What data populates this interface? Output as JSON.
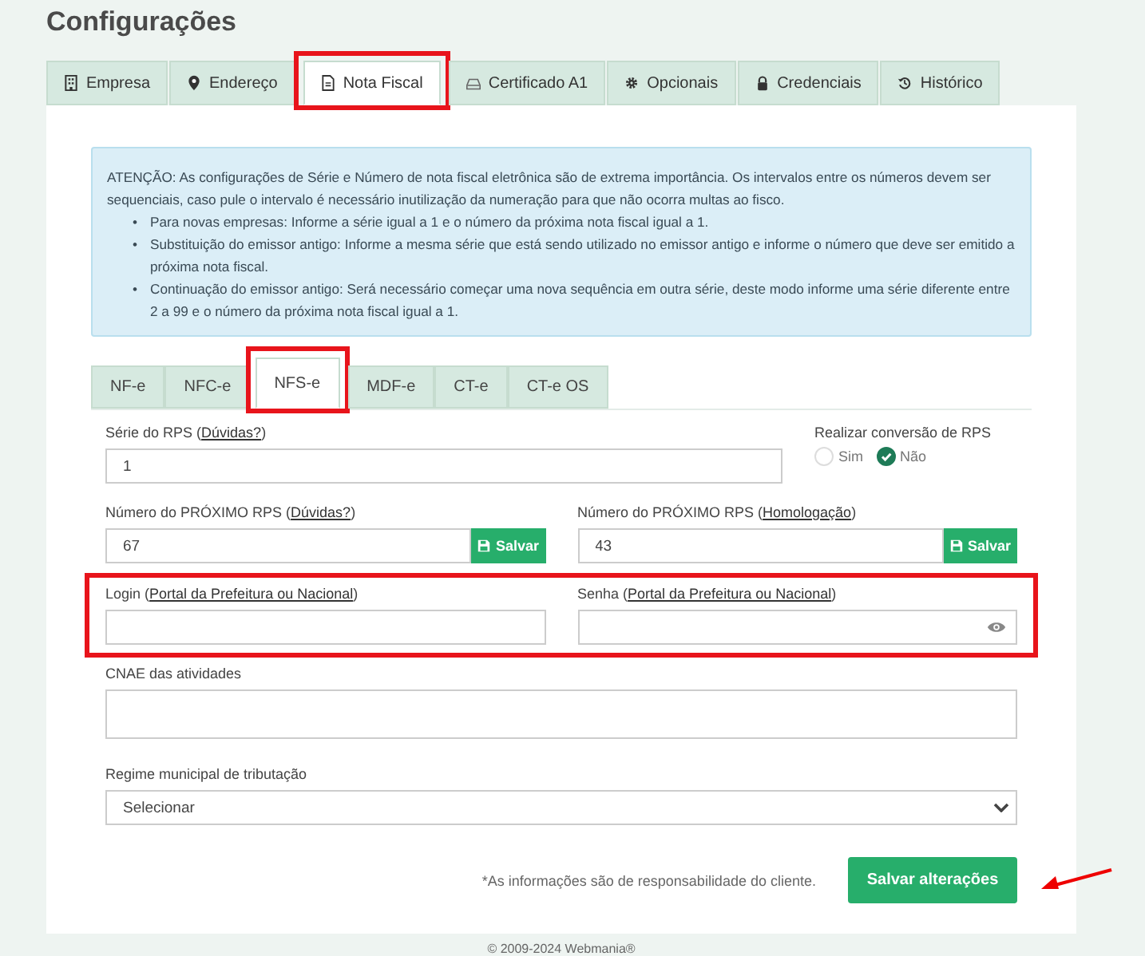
{
  "page_title": "Configurações",
  "tabs": [
    {
      "label": "Empresa",
      "selected": false,
      "highlighted": false
    },
    {
      "label": "Endereço",
      "selected": false,
      "highlighted": false
    },
    {
      "label": "Nota Fiscal",
      "selected": true,
      "highlighted": true
    },
    {
      "label": "Certificado A1",
      "selected": false,
      "highlighted": false
    },
    {
      "label": "Opcionais",
      "selected": false,
      "highlighted": false
    },
    {
      "label": "Credenciais",
      "selected": false,
      "highlighted": false
    },
    {
      "label": "Histórico",
      "selected": false,
      "highlighted": false
    }
  ],
  "notice": {
    "intro": "ATENÇÃO: As configurações de Série e Número de nota fiscal eletrônica são de extrema importância. Os intervalos entre os números devem ser sequenciais, caso pule o intervalo é necessário inutilização da numeração para que não ocorra multas ao fisco.",
    "items": [
      {
        "bullet": "•",
        "text": "Para novas empresas: Informe a série igual a 1 e o número da próxima nota fiscal igual a 1."
      },
      {
        "bullet": "•",
        "text": "Substituição do emissor antigo: Informe a mesma série que está sendo utilizado no emissor antigo e informe o número que deve ser emitido a próxima nota fiscal."
      },
      {
        "bullet": "•",
        "text": "Continuação do emissor antigo: Será necessário começar uma nova sequência em outra série, deste modo informe uma série diferente entre 2 a 99 e o número da próxima nota fiscal igual a 1."
      }
    ]
  },
  "subtabs": [
    {
      "label": "NF-e",
      "selected": false,
      "highlighted": false
    },
    {
      "label": "NFC-e",
      "selected": false,
      "highlighted": false
    },
    {
      "label": "NFS-e",
      "selected": true,
      "highlighted": true
    },
    {
      "label": "MDF-e",
      "selected": false,
      "highlighted": false
    },
    {
      "label": "CT-e",
      "selected": false,
      "highlighted": false
    },
    {
      "label": "CT-e OS",
      "selected": false,
      "highlighted": false
    }
  ],
  "form": {
    "serie": {
      "label": "Série do RPS (",
      "link": "Dúvidas?",
      "after": ")",
      "value": "1"
    },
    "conversion": {
      "label": "Realizar conversão de RPS",
      "options": [
        {
          "label": "Sim",
          "selected": false
        },
        {
          "label": "Não",
          "selected": true
        }
      ]
    },
    "next_rps": [
      {
        "label": "Número do PRÓXIMO RPS (",
        "link": "Dúvidas?",
        "after": ")",
        "value": "67",
        "button": "Salvar"
      },
      {
        "label": "Número do PRÓXIMO RPS (",
        "link": "Homologação",
        "after": ")",
        "value": "43",
        "button": "Salvar"
      }
    ],
    "credentials_highlighted": true,
    "login": {
      "label": "Login (",
      "link": "Portal da Prefeitura ou Nacional",
      "after": ")"
    },
    "password": {
      "label": "Senha (",
      "link": "Portal da Prefeitura ou Nacional",
      "after": ")"
    },
    "cnae": {
      "label": "CNAE das atividades"
    },
    "regime": {
      "label": "Regime municipal de tributação",
      "value": "Selecionar"
    }
  },
  "disclaimer": "*As informações são de responsabilidade do cliente.",
  "save_button": "Salvar alterações",
  "save_arrow": true,
  "footer": "© 2009-2024 Webmania®"
}
